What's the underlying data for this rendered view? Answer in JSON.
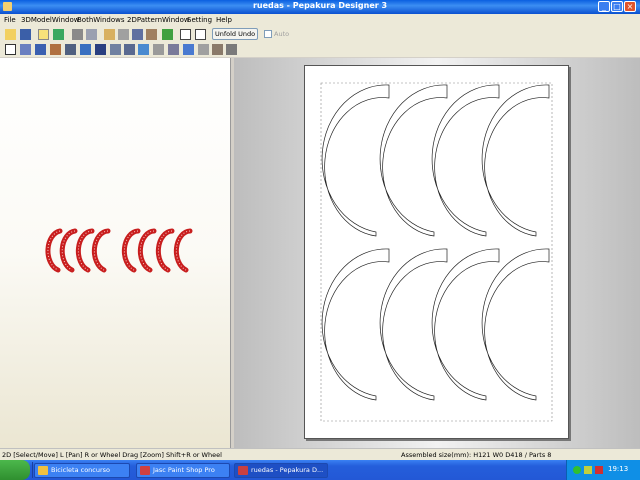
{
  "window": {
    "title": "ruedas - Pepakura Designer 3"
  },
  "menu": [
    "File",
    "3DModelWindow",
    "BothWindows",
    "2DPatternWindow",
    "Setting",
    "Help"
  ],
  "toolbar": {
    "unfold_undo": "Unfold Undo",
    "auto_label": "Auto"
  },
  "status": {
    "hint": "2D [Select/Move] L [Pan] R or Wheel Drag [Zoom] Shift+R or Wheel",
    "assembled": "Assembled size(mm): H121 W0 D418 / Parts 8"
  },
  "taskbar": {
    "tasks": [
      {
        "label": "Bicicleta concurso",
        "icon_color": "#f0c040"
      },
      {
        "label": "Jasc Paint Shop Pro",
        "icon_color": "#d04040"
      },
      {
        "label": "ruedas - Pepakura D...",
        "icon_color": "#c84040"
      }
    ],
    "clock": "19:13"
  },
  "colors": {
    "model_red": "#c81e1e",
    "title_blue": "#0a5fe0",
    "paper": "#ffffff"
  },
  "icons": [
    "new-file-icon",
    "open-folder-icon",
    "save-icon",
    "undo-icon",
    "redo-icon",
    "print-icon"
  ]
}
